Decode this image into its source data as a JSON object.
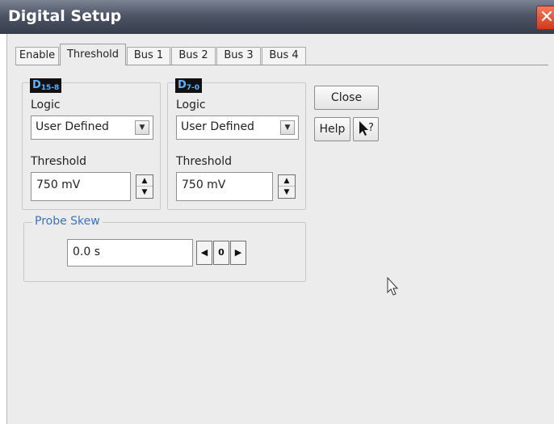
{
  "window": {
    "title": "Digital Setup",
    "close_glyph": "✕"
  },
  "tabs": [
    {
      "label": "Enable",
      "active": false
    },
    {
      "label": "Threshold",
      "active": true
    },
    {
      "label": "Bus 1",
      "active": false
    },
    {
      "label": "Bus 2",
      "active": false
    },
    {
      "label": "Bus 3",
      "active": false
    },
    {
      "label": "Bus 4",
      "active": false
    }
  ],
  "group_d15_8": {
    "badge_main": "D",
    "badge_sub": "15-8",
    "logic_label": "Logic",
    "logic_value": "User Defined",
    "threshold_label": "Threshold",
    "threshold_value": "750 mV"
  },
  "group_d7_0": {
    "badge_main": "D",
    "badge_sub": "7-0",
    "logic_label": "Logic",
    "logic_value": "User Defined",
    "threshold_label": "Threshold",
    "threshold_value": "750 mV"
  },
  "buttons": {
    "close": "Close",
    "help": "Help",
    "whats_this": "?"
  },
  "probe_skew": {
    "legend": "Probe Skew",
    "value": "0.0 s",
    "zero_label": "0"
  },
  "icons": {
    "dropdown": "chevron-down-icon",
    "spin_up": "triangle-up-icon",
    "spin_down": "triangle-down-icon",
    "left": "triangle-left-icon",
    "right": "triangle-right-icon",
    "pointer": "mouse-pointer-icon"
  },
  "colors": {
    "badge_text": "#5ab4ff",
    "legend_text": "#3a72c4",
    "close_button": "#d5381b"
  }
}
